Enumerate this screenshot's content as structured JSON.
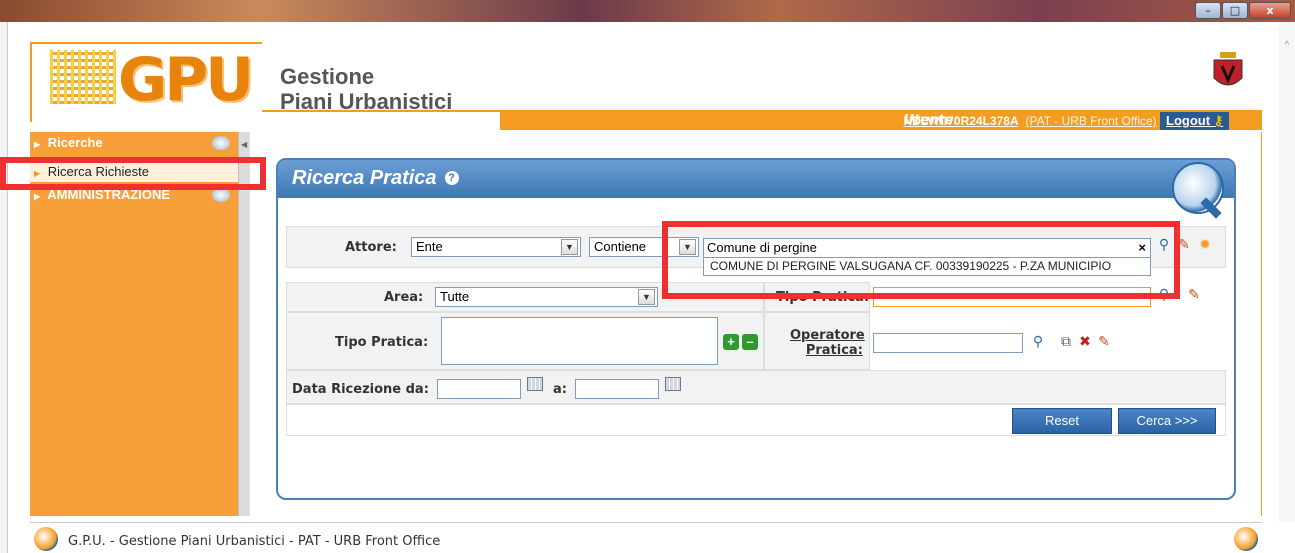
{
  "window": {
    "minimize": "–",
    "maximize": "□",
    "close": "x"
  },
  "header": {
    "logo": "GPU",
    "title_line1": "Gestione",
    "title_line2": "Piani Urbanistici",
    "user_label": "Utente:",
    "user_value": "NDLVNI70R24L378A",
    "user_role": "(PAT - URB Front Office)",
    "logout": "Logout"
  },
  "sidebar": {
    "section1": "Ricerche",
    "item1": "Ricerca Richieste",
    "section2": "AMMINISTRAZIONE"
  },
  "panel": {
    "title": "Ricerca Pratica",
    "attore_label": "Attore:",
    "attore_value": "Ente",
    "operator_value": "Contiene",
    "search_value": "Comune di pergine",
    "suggestion": "COMUNE DI PERGINE VALSUGANA CF. 00339190225 - P.ZA MUNICIPIO",
    "area_label": "Area:",
    "area_value": "Tutte",
    "tipo_pratica_right_label": "Tipo Pratica:",
    "tipo_pratica_label": "Tipo Pratica:",
    "operatore_label_1": "Operatore",
    "operatore_label_2": "Pratica:",
    "data_label": "Data Ricezione da:",
    "data_a_label": "a:",
    "reset": "Reset",
    "cerca": "Cerca >>>"
  },
  "footer": {
    "text": "G.P.U. - Gestione Piani Urbanistici - PAT - URB Front Office"
  },
  "colors": {
    "accent": "#f39c1f",
    "panel_blue": "#3f77b3",
    "highlight_red": "#f03030"
  },
  "icons": [
    "search-icon",
    "edit-icon",
    "settings-icon",
    "add-icon",
    "remove-icon",
    "calendar-icon",
    "delete-icon",
    "crest-icon",
    "help-icon"
  ]
}
